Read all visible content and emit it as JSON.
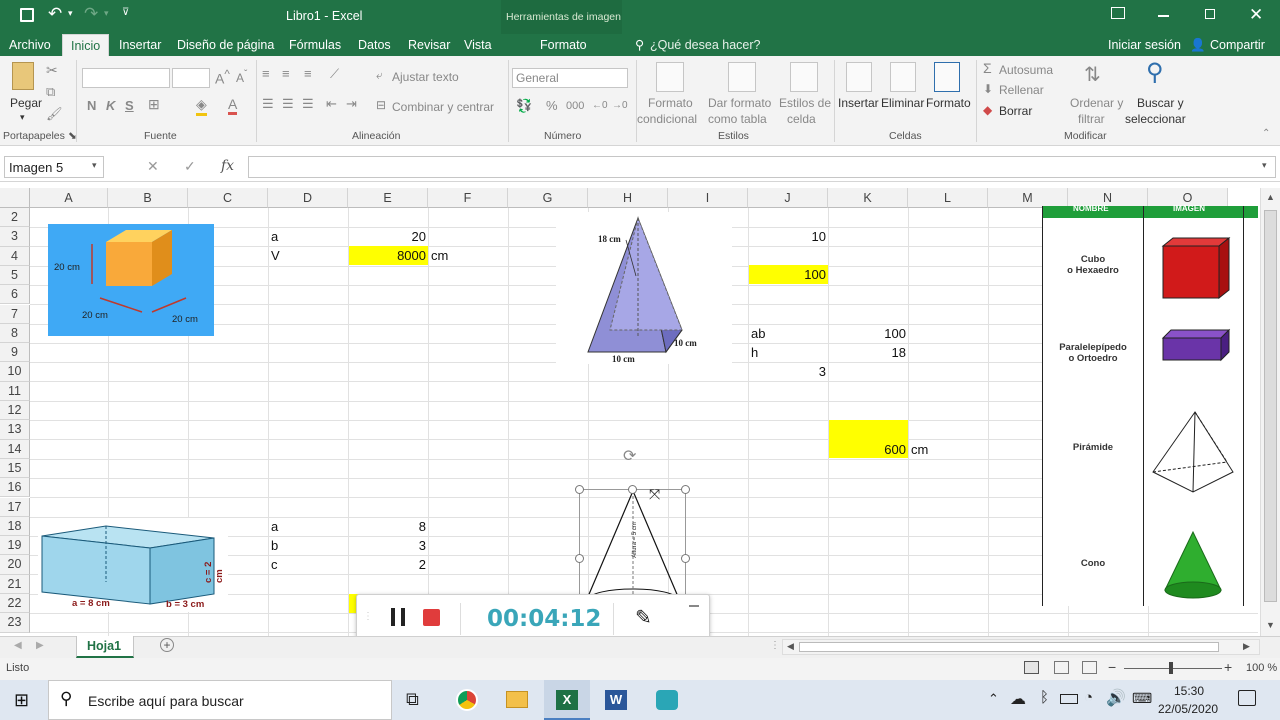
{
  "title_bar": {
    "title": "Libro1 - Excel",
    "context_tool": "Herramientas de imagen",
    "format_tab": "Formato"
  },
  "tabs": [
    "Archivo",
    "Inicio",
    "Insertar",
    "Diseño de página",
    "Fórmulas",
    "Datos",
    "Revisar",
    "Vista"
  ],
  "tell_me": "¿Qué desea hacer?",
  "sign_in": "Iniciar sesión",
  "share": "Compartir",
  "ribbon": {
    "paste": "Pegar",
    "clipboard_group": "Portapapeles",
    "font_group": "Fuente",
    "bold": "N",
    "italic": "K",
    "underline": "S",
    "wrap_text": "Ajustar texto",
    "merge_center": "Combinar y centrar",
    "alignment_group": "Alineación",
    "number_format": "General",
    "number_group": "Número",
    "cond_format_1": "Formato",
    "cond_format_2": "condicional",
    "format_table_1": "Dar formato",
    "format_table_2": "como tabla",
    "cell_styles_1": "Estilos de",
    "cell_styles_2": "celda",
    "styles_group": "Estilos",
    "insert": "Insertar",
    "delete": "Eliminar",
    "format": "Formato",
    "cells_group": "Celdas",
    "autosum": "Autosuma",
    "fill": "Rellenar",
    "clear": "Borrar",
    "sort_1": "Ordenar y",
    "sort_2": "filtrar",
    "find_1": "Buscar y",
    "find_2": "seleccionar",
    "modify_group": "Modificar"
  },
  "formula_bar": {
    "name_box": "Imagen 5",
    "fx": "fx",
    "value": ""
  },
  "columns": [
    "A",
    "B",
    "C",
    "D",
    "E",
    "F",
    "G",
    "H",
    "I",
    "J",
    "K",
    "L",
    "M",
    "N",
    "O"
  ],
  "rows": [
    "2",
    "3",
    "4",
    "5",
    "6",
    "7",
    "8",
    "9",
    "10",
    "11",
    "12",
    "13",
    "14",
    "15",
    "16",
    "17",
    "18",
    "19",
    "20",
    "21",
    "22",
    "23"
  ],
  "cells": {
    "d3": "a",
    "e3": "20",
    "d4": "V",
    "e4": "8000",
    "f4": "cm",
    "j3": "10",
    "j5": "100",
    "j8": "ab",
    "k8": "100",
    "j9": "h",
    "k9": "18",
    "j10": "3",
    "k14": "600",
    "l14": "cm",
    "d18": "a",
    "e18": "8",
    "d19": "b",
    "e19": "3",
    "d20": "c",
    "e20": "2"
  },
  "images": {
    "cube": {
      "label_h": "20 cm",
      "label_w": "20 cm",
      "label_d": "20 cm"
    },
    "pyramid": {
      "slant": "18 cm",
      "base_w": "10 cm",
      "base_d": "10 cm"
    },
    "cone": {
      "height": "Altura = 5 cm"
    },
    "prism": {
      "a": "a = 8 cm",
      "b": "b = 3 cm",
      "c": "c = 2 cm"
    },
    "table": {
      "header_name": "NOMBRE",
      "header_image": "IMAGEN",
      "rows": [
        {
          "name": "Cubo\no Hexaedro"
        },
        {
          "name": "Paralelepípedo\no Ortoedro"
        },
        {
          "name": "Pirámide"
        },
        {
          "name": "Cono"
        }
      ]
    }
  },
  "recorder": {
    "time": "00:04:12"
  },
  "sheet_tab": "Hoja1",
  "status": "Listo",
  "zoom": "100 %",
  "taskbar": {
    "search": "Escribe aquí para buscar",
    "time": "15:30",
    "date": "22/05/2020"
  },
  "colors": {
    "excel_green": "#217346",
    "highlight": "#ffff00",
    "recorder_time": "#3aa6b9"
  }
}
